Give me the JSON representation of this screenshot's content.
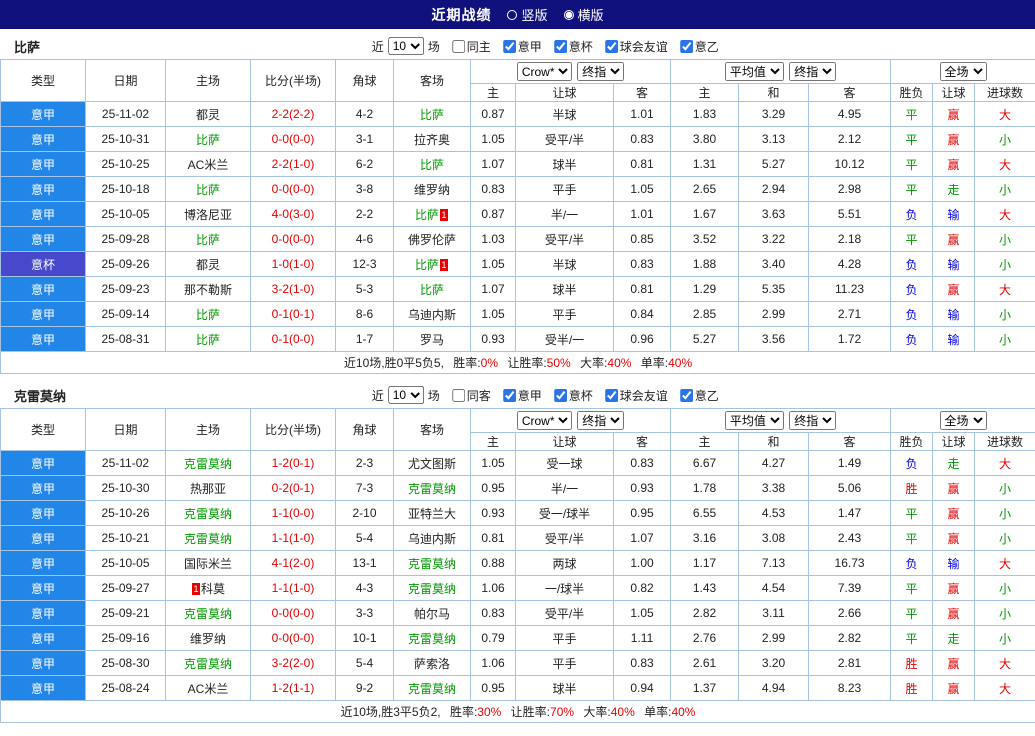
{
  "colors": {
    "topbar_bg": "#11117d",
    "league_bg": "#2285e8",
    "cup_bg": "#4848cc",
    "team_green": "#009900",
    "score_red": "#e60000",
    "win_red": "#e60000",
    "draw_green": "#009900",
    "lose_blue": "#0000e6",
    "border_c": "#a6c3e3"
  },
  "topbar": {
    "title": "近期战绩",
    "vertical_label": "竖版",
    "horizontal_label": "横版"
  },
  "header": {
    "col_type": "类型",
    "col_date": "日期",
    "col_home": "主场",
    "col_score": "比分(半场)",
    "col_corner": "角球",
    "col_away": "客场",
    "bookmaker": "Crow*",
    "final_odds": "终指",
    "average": "平均值",
    "full_match": "全场",
    "sub_home": "主",
    "sub_handicap": "让球",
    "sub_away": "客",
    "sub_avg_home": "主",
    "sub_avg_draw": "和",
    "sub_avg_away": "客",
    "sub_result": "胜负",
    "sub_handicap_result": "让球",
    "sub_goals": "进球数"
  },
  "filter_labels": {
    "recent": "近",
    "count": "10",
    "matches": "场"
  },
  "sections": [
    {
      "team": "比萨",
      "filter_checks": [
        {
          "label": "同主",
          "checked": false
        },
        {
          "label": "意甲",
          "checked": true
        },
        {
          "label": "意杯",
          "checked": true
        },
        {
          "label": "球会友谊",
          "checked": true
        },
        {
          "label": "意乙",
          "checked": true
        }
      ],
      "rows": [
        {
          "league": "意甲",
          "cup": false,
          "date": "25-11-02",
          "home": "都灵",
          "home_team": false,
          "home_rc": false,
          "score": "2-2(2-2)",
          "corner": "4-2",
          "away": "比萨",
          "away_team": true,
          "away_rc": false,
          "o1": "0.87",
          "hcap": "半球",
          "o2": "1.01",
          "a1": "1.83",
          "a2": "3.29",
          "a3": "4.95",
          "r1": "平",
          "r2": "赢",
          "r3": "大"
        },
        {
          "league": "意甲",
          "cup": false,
          "date": "25-10-31",
          "home": "比萨",
          "home_team": true,
          "home_rc": false,
          "score": "0-0(0-0)",
          "corner": "3-1",
          "away": "拉齐奥",
          "away_team": false,
          "away_rc": false,
          "o1": "1.05",
          "hcap": "受平/半",
          "o2": "0.83",
          "a1": "3.80",
          "a2": "3.13",
          "a3": "2.12",
          "r1": "平",
          "r2": "赢",
          "r3": "小"
        },
        {
          "league": "意甲",
          "cup": false,
          "date": "25-10-25",
          "home": "AC米兰",
          "home_team": false,
          "home_rc": false,
          "score": "2-2(1-0)",
          "corner": "6-2",
          "away": "比萨",
          "away_team": true,
          "away_rc": false,
          "o1": "1.07",
          "hcap": "球半",
          "o2": "0.81",
          "a1": "1.31",
          "a2": "5.27",
          "a3": "10.12",
          "r1": "平",
          "r2": "赢",
          "r3": "大"
        },
        {
          "league": "意甲",
          "cup": false,
          "date": "25-10-18",
          "home": "比萨",
          "home_team": true,
          "home_rc": false,
          "score": "0-0(0-0)",
          "corner": "3-8",
          "away": "维罗纳",
          "away_team": false,
          "away_rc": false,
          "o1": "0.83",
          "hcap": "平手",
          "o2": "1.05",
          "a1": "2.65",
          "a2": "2.94",
          "a3": "2.98",
          "r1": "平",
          "r2": "走",
          "r3": "小"
        },
        {
          "league": "意甲",
          "cup": false,
          "date": "25-10-05",
          "home": "博洛尼亚",
          "home_team": false,
          "home_rc": false,
          "score": "4-0(3-0)",
          "corner": "2-2",
          "away": "比萨",
          "away_team": true,
          "away_rc": true,
          "o1": "0.87",
          "hcap": "半/一",
          "o2": "1.01",
          "a1": "1.67",
          "a2": "3.63",
          "a3": "5.51",
          "r1": "负",
          "r2": "输",
          "r3": "大"
        },
        {
          "league": "意甲",
          "cup": false,
          "date": "25-09-28",
          "home": "比萨",
          "home_team": true,
          "home_rc": false,
          "score": "0-0(0-0)",
          "corner": "4-6",
          "away": "佛罗伦萨",
          "away_team": false,
          "away_rc": false,
          "o1": "1.03",
          "hcap": "受平/半",
          "o2": "0.85",
          "a1": "3.52",
          "a2": "3.22",
          "a3": "2.18",
          "r1": "平",
          "r2": "赢",
          "r3": "小"
        },
        {
          "league": "意杯",
          "cup": true,
          "date": "25-09-26",
          "home": "都灵",
          "home_team": false,
          "home_rc": false,
          "score": "1-0(1-0)",
          "corner": "12-3",
          "away": "比萨",
          "away_team": true,
          "away_rc": true,
          "o1": "1.05",
          "hcap": "半球",
          "o2": "0.83",
          "a1": "1.88",
          "a2": "3.40",
          "a3": "4.28",
          "r1": "负",
          "r2": "输",
          "r3": "小"
        },
        {
          "league": "意甲",
          "cup": false,
          "date": "25-09-23",
          "home": "那不勒斯",
          "home_team": false,
          "home_rc": false,
          "score": "3-2(1-0)",
          "corner": "5-3",
          "away": "比萨",
          "away_team": true,
          "away_rc": false,
          "o1": "1.07",
          "hcap": "球半",
          "o2": "0.81",
          "a1": "1.29",
          "a2": "5.35",
          "a3": "11.23",
          "r1": "负",
          "r2": "赢",
          "r3": "大"
        },
        {
          "league": "意甲",
          "cup": false,
          "date": "25-09-14",
          "home": "比萨",
          "home_team": true,
          "home_rc": false,
          "score": "0-1(0-1)",
          "corner": "8-6",
          "away": "乌迪内斯",
          "away_team": false,
          "away_rc": false,
          "o1": "1.05",
          "hcap": "平手",
          "o2": "0.84",
          "a1": "2.85",
          "a2": "2.99",
          "a3": "2.71",
          "r1": "负",
          "r2": "输",
          "r3": "小"
        },
        {
          "league": "意甲",
          "cup": false,
          "date": "25-08-31",
          "home": "比萨",
          "home_team": true,
          "home_rc": false,
          "score": "0-1(0-0)",
          "corner": "1-7",
          "away": "罗马",
          "away_team": false,
          "away_rc": false,
          "o1": "0.93",
          "hcap": "受半/一",
          "o2": "0.96",
          "a1": "5.27",
          "a2": "3.56",
          "a3": "1.72",
          "r1": "负",
          "r2": "输",
          "r3": "小"
        }
      ],
      "summary": {
        "record": "近10场,胜0平5负5,",
        "win_label": "胜率:",
        "win_value": "0%",
        "handicap_label": "让胜率:",
        "handicap_value": "50%",
        "big_label": "大率:",
        "big_value": "40%",
        "single_label": "单率:",
        "single_value": "40%"
      }
    },
    {
      "team": "克雷莫纳",
      "filter_checks": [
        {
          "label": "同客",
          "checked": false
        },
        {
          "label": "意甲",
          "checked": true
        },
        {
          "label": "意杯",
          "checked": true
        },
        {
          "label": "球会友谊",
          "checked": true
        },
        {
          "label": "意乙",
          "checked": true
        }
      ],
      "rows": [
        {
          "league": "意甲",
          "cup": false,
          "date": "25-11-02",
          "home": "克雷莫纳",
          "home_team": true,
          "home_rc": false,
          "score": "1-2(0-1)",
          "corner": "2-3",
          "away": "尤文图斯",
          "away_team": false,
          "away_rc": false,
          "o1": "1.05",
          "hcap": "受一球",
          "o2": "0.83",
          "a1": "6.67",
          "a2": "4.27",
          "a3": "1.49",
          "r1": "负",
          "r2": "走",
          "r3": "大"
        },
        {
          "league": "意甲",
          "cup": false,
          "date": "25-10-30",
          "home": "热那亚",
          "home_team": false,
          "home_rc": false,
          "score": "0-2(0-1)",
          "corner": "7-3",
          "away": "克雷莫纳",
          "away_team": true,
          "away_rc": false,
          "o1": "0.95",
          "hcap": "半/一",
          "o2": "0.93",
          "a1": "1.78",
          "a2": "3.38",
          "a3": "5.06",
          "r1": "胜",
          "r2": "赢",
          "r3": "小"
        },
        {
          "league": "意甲",
          "cup": false,
          "date": "25-10-26",
          "home": "克雷莫纳",
          "home_team": true,
          "home_rc": false,
          "score": "1-1(0-0)",
          "corner": "2-10",
          "away": "亚特兰大",
          "away_team": false,
          "away_rc": false,
          "o1": "0.93",
          "hcap": "受一/球半",
          "o2": "0.95",
          "a1": "6.55",
          "a2": "4.53",
          "a3": "1.47",
          "r1": "平",
          "r2": "赢",
          "r3": "小"
        },
        {
          "league": "意甲",
          "cup": false,
          "date": "25-10-21",
          "home": "克雷莫纳",
          "home_team": true,
          "home_rc": false,
          "score": "1-1(1-0)",
          "corner": "5-4",
          "away": "乌迪内斯",
          "away_team": false,
          "away_rc": false,
          "o1": "0.81",
          "hcap": "受平/半",
          "o2": "1.07",
          "a1": "3.16",
          "a2": "3.08",
          "a3": "2.43",
          "r1": "平",
          "r2": "赢",
          "r3": "小"
        },
        {
          "league": "意甲",
          "cup": false,
          "date": "25-10-05",
          "home": "国际米兰",
          "home_team": false,
          "home_rc": false,
          "score": "4-1(2-0)",
          "corner": "13-1",
          "away": "克雷莫纳",
          "away_team": true,
          "away_rc": false,
          "o1": "0.88",
          "hcap": "两球",
          "o2": "1.00",
          "a1": "1.17",
          "a2": "7.13",
          "a3": "16.73",
          "r1": "负",
          "r2": "输",
          "r3": "大"
        },
        {
          "league": "意甲",
          "cup": false,
          "date": "25-09-27",
          "home": "科莫",
          "home_team": false,
          "home_rc": true,
          "score": "1-1(1-0)",
          "corner": "4-3",
          "away": "克雷莫纳",
          "away_team": true,
          "away_rc": false,
          "o1": "1.06",
          "hcap": "一/球半",
          "o2": "0.82",
          "a1": "1.43",
          "a2": "4.54",
          "a3": "7.39",
          "r1": "平",
          "r2": "赢",
          "r3": "小"
        },
        {
          "league": "意甲",
          "cup": false,
          "date": "25-09-21",
          "home": "克雷莫纳",
          "home_team": true,
          "home_rc": false,
          "score": "0-0(0-0)",
          "corner": "3-3",
          "away": "帕尔马",
          "away_team": false,
          "away_rc": false,
          "o1": "0.83",
          "hcap": "受平/半",
          "o2": "1.05",
          "a1": "2.82",
          "a2": "3.11",
          "a3": "2.66",
          "r1": "平",
          "r2": "赢",
          "r3": "小"
        },
        {
          "league": "意甲",
          "cup": false,
          "date": "25-09-16",
          "home": "维罗纳",
          "home_team": false,
          "home_rc": false,
          "score": "0-0(0-0)",
          "corner": "10-1",
          "away": "克雷莫纳",
          "away_team": true,
          "away_rc": false,
          "o1": "0.79",
          "hcap": "平手",
          "o2": "1.11",
          "a1": "2.76",
          "a2": "2.99",
          "a3": "2.82",
          "r1": "平",
          "r2": "走",
          "r3": "小"
        },
        {
          "league": "意甲",
          "cup": false,
          "date": "25-08-30",
          "home": "克雷莫纳",
          "home_team": true,
          "home_rc": false,
          "score": "3-2(2-0)",
          "corner": "5-4",
          "away": "萨索洛",
          "away_team": false,
          "away_rc": false,
          "o1": "1.06",
          "hcap": "平手",
          "o2": "0.83",
          "a1": "2.61",
          "a2": "3.20",
          "a3": "2.81",
          "r1": "胜",
          "r2": "赢",
          "r3": "大"
        },
        {
          "league": "意甲",
          "cup": false,
          "date": "25-08-24",
          "home": "AC米兰",
          "home_team": false,
          "home_rc": false,
          "score": "1-2(1-1)",
          "corner": "9-2",
          "away": "克雷莫纳",
          "away_team": true,
          "away_rc": false,
          "o1": "0.95",
          "hcap": "球半",
          "o2": "0.94",
          "a1": "1.37",
          "a2": "4.94",
          "a3": "8.23",
          "r1": "胜",
          "r2": "赢",
          "r3": "大"
        }
      ],
      "summary": {
        "record": "近10场,胜3平5负2,",
        "win_label": "胜率:",
        "win_value": "30%",
        "handicap_label": "让胜率:",
        "handicap_value": "70%",
        "big_label": "大率:",
        "big_value": "40%",
        "single_label": "单率:",
        "single_value": "40%"
      }
    }
  ]
}
